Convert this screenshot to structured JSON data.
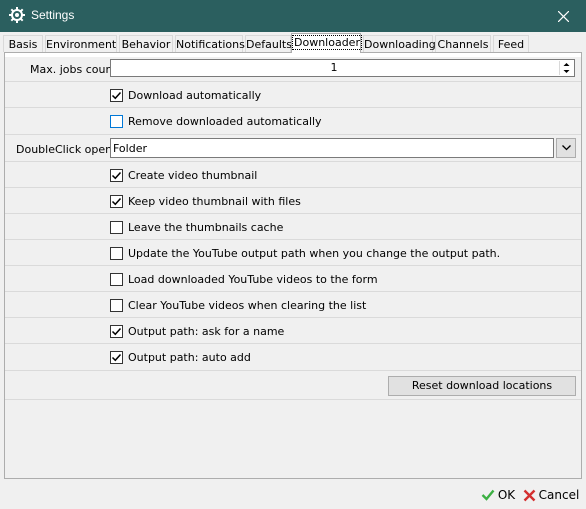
{
  "window": {
    "title": "Settings",
    "icon": "gear-icon",
    "close_icon": "close-icon"
  },
  "tabs": [
    {
      "label": "Basis"
    },
    {
      "label": "Environment"
    },
    {
      "label": "Behavior"
    },
    {
      "label": "Notifications"
    },
    {
      "label": "Defaults"
    },
    {
      "label": "Downloader"
    },
    {
      "label": "Downloading"
    },
    {
      "label": "Channels"
    },
    {
      "label": "Feed"
    }
  ],
  "active_tab": "Downloader",
  "max_jobs": {
    "label": "Max. jobs count",
    "value": "1"
  },
  "options": {
    "download_automatically": {
      "label": "Download automatically",
      "checked": true
    },
    "remove_downloaded": {
      "label": "Remove downloaded automatically",
      "checked": false
    },
    "create_thumbnail": {
      "label": "Create video thumbnail",
      "checked": true
    },
    "keep_thumbnail": {
      "label": "Keep video thumbnail with files",
      "checked": true
    },
    "leave_cache": {
      "label": "Leave the thumbnails cache",
      "checked": false
    },
    "update_output_path": {
      "label": "Update the YouTube output path when you change the output path.",
      "checked": false
    },
    "load_downloaded": {
      "label": "Load downloaded YouTube videos to the form",
      "checked": false
    },
    "clear_youtube": {
      "label": "Clear YouTube videos when clearing the list",
      "checked": false
    },
    "ask_name": {
      "label": "Output path: ask for a name",
      "checked": true
    },
    "auto_add": {
      "label": "Output path: auto add",
      "checked": true
    }
  },
  "doubleclick": {
    "label": "DoubleClick opens",
    "value": "Folder"
  },
  "reset_button": "Reset download locations",
  "ok_button": "OK",
  "cancel_button": "Cancel",
  "colors": {
    "titlebar": "#2b5f5f",
    "ok_check": "#3cb043",
    "cancel_x": "#d32f2f"
  }
}
